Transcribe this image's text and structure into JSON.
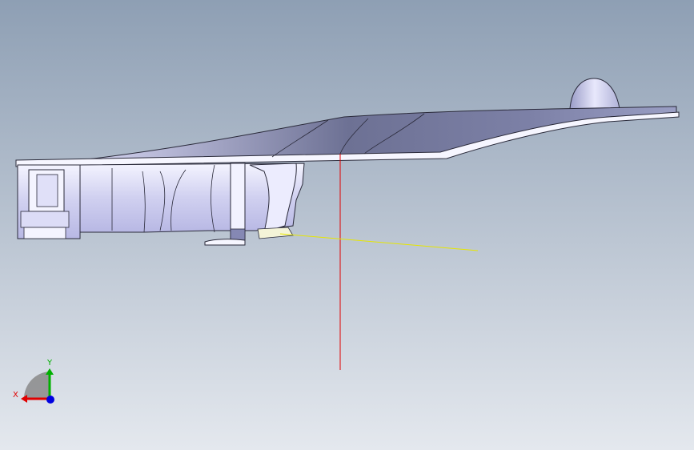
{
  "viewport": {
    "background_top": "#8e9fb4",
    "background_bottom": "#e4e8ee"
  },
  "model": {
    "name_icon": "cad-part-model",
    "surface_color": "#c8c8ec",
    "surface_dark": "#5a5f80",
    "edge_color": "#2a2a3a",
    "highlight_color": "#ffffff"
  },
  "reference_lines": {
    "vertical_color": "#e00000",
    "horizontal_color": "#e6e600"
  },
  "triad": {
    "x_label": "X",
    "y_label": "Y",
    "x_color": "#e00000",
    "y_color": "#00b000",
    "z_color": "#0000e0"
  }
}
